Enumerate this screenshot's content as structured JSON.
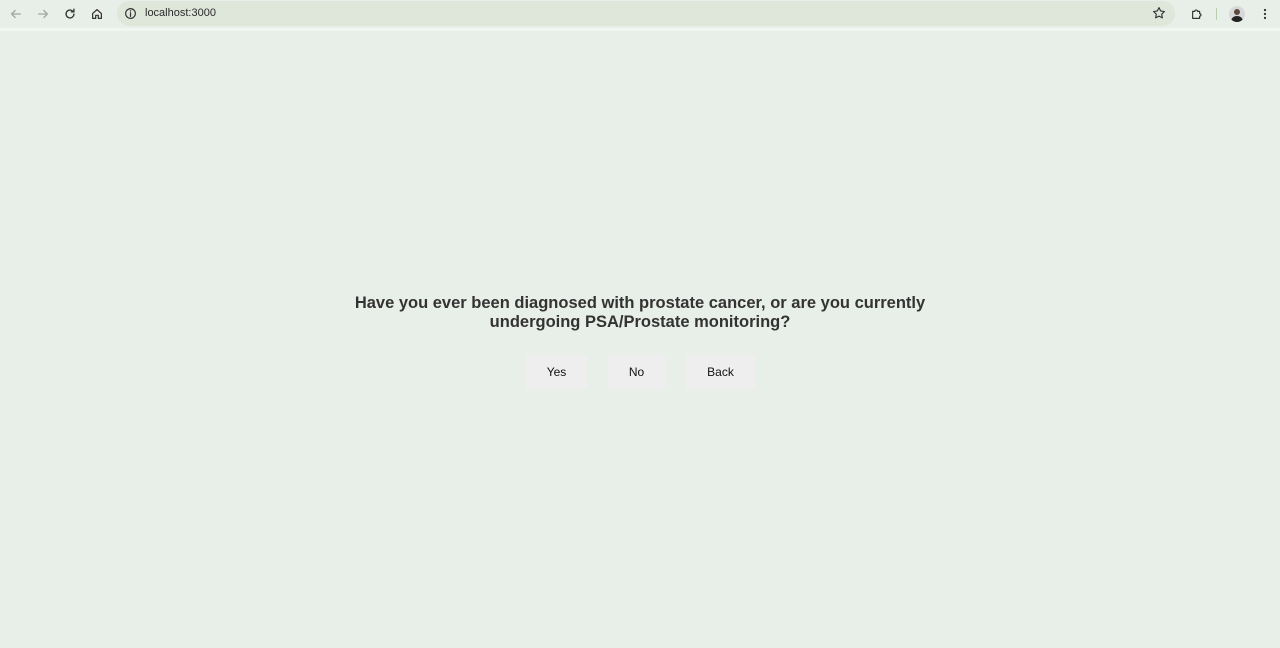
{
  "browser": {
    "url": "localhost:3000",
    "icons": {
      "back": "arrow-left-icon",
      "forward": "arrow-right-icon",
      "reload": "reload-icon",
      "home": "home-icon",
      "site_info": "info-circle-icon",
      "bookmark": "star-icon",
      "extensions": "puzzle-icon",
      "profile": "avatar",
      "menu": "kebab-menu-icon"
    }
  },
  "page": {
    "background": "#e8eee8",
    "question": "Have you ever been diagnosed with prostate cancer, or are you currently undergoing PSA/Prostate monitoring?",
    "buttons": {
      "yes": "Yes",
      "no": "No",
      "back": "Back"
    }
  }
}
